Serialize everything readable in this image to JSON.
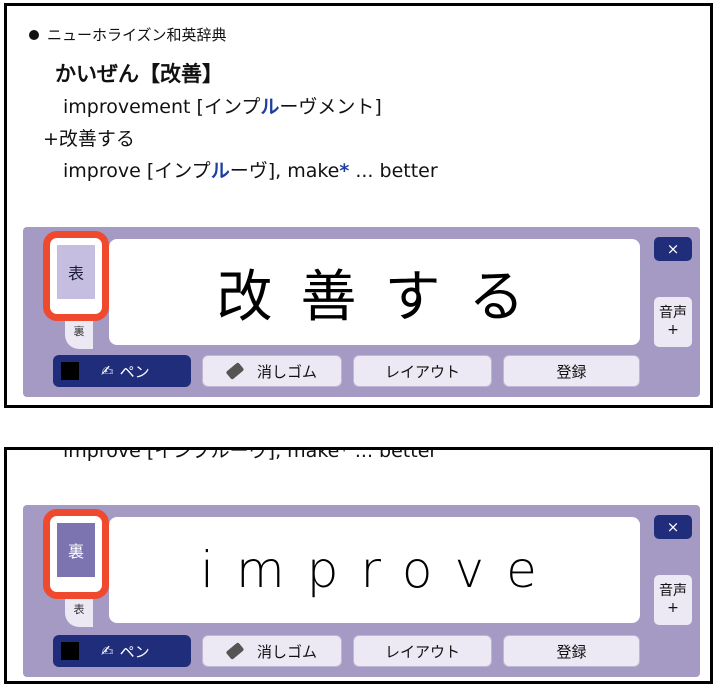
{
  "top": {
    "dictionary_name": "ニューホライズン和英辞典",
    "headword": "かいぜん【改善】",
    "entry_line1": {
      "a": "improvement [インプ",
      "b": "ル",
      "c": "ーヴメント]"
    },
    "entry_line2": "+改善する",
    "entry_line3": {
      "a": "improve [インプ",
      "b": "ル",
      "c": "ーヴ], make",
      "star": "*",
      "d": " ... better"
    },
    "handwriting": "改善する",
    "side_tab_label": "表",
    "corner_label": "裏"
  },
  "bottom": {
    "partial_line": "improve [インプルーヴ], make* ... better",
    "handwriting": "improve",
    "side_tab_label": "裏",
    "corner_label": "表"
  },
  "controls": {
    "close_label": "×",
    "voice_label_line1": "音声",
    "voice_label_line2": "+",
    "pen_label": "ペン",
    "eraser_label": "消しゴム",
    "layout_label": "レイアウト",
    "register_label": "登録"
  },
  "colors": {
    "panel": "#a49ac3",
    "highlight": "#f04a2e",
    "pen_button": "#1f2d7a",
    "accent_text": "#1f3fa0"
  }
}
